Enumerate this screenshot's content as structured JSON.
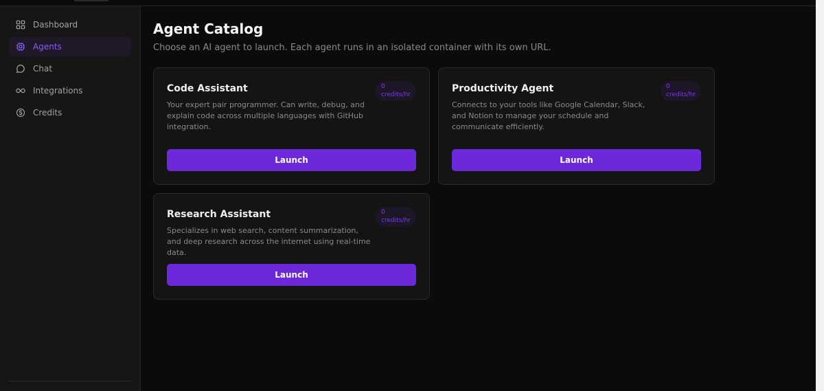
{
  "sidebar": {
    "items": [
      {
        "label": "Dashboard",
        "icon": "grid-icon",
        "active": false
      },
      {
        "label": "Agents",
        "icon": "chip-icon",
        "active": true
      },
      {
        "label": "Chat",
        "icon": "chat-bubble-icon",
        "active": false
      },
      {
        "label": "Integrations",
        "icon": "infinity-icon",
        "active": false
      },
      {
        "label": "Credits",
        "icon": "dollar-circle-icon",
        "active": false
      }
    ]
  },
  "main": {
    "title": "Agent Catalog",
    "subtitle": "Choose an AI agent to launch. Each agent runs in an isolated container with its own URL."
  },
  "agents": [
    {
      "name": "Code Assistant",
      "description": "Your expert pair programmer. Can write, debug, and explain code across multiple languages with GitHub integration.",
      "credits_value": "0",
      "credits_unit": "credits/hr",
      "launch_label": "Launch"
    },
    {
      "name": "Productivity Agent",
      "description": "Connects to your tools like Google Calendar, Slack, and Notion to manage your schedule and communicate efficiently.",
      "credits_value": "0",
      "credits_unit": "credits/hr",
      "launch_label": "Launch"
    },
    {
      "name": "Research Assistant",
      "description": "Specializes in web search, content summarization, and deep research across the internet using real-time data.",
      "credits_value": "0",
      "credits_unit": "credits/hr",
      "launch_label": "Launch"
    }
  ],
  "colors": {
    "accent": "#6d28d9",
    "accent_text": "#8b5cf6",
    "background": "#0b0b0b",
    "card": "#141414"
  }
}
